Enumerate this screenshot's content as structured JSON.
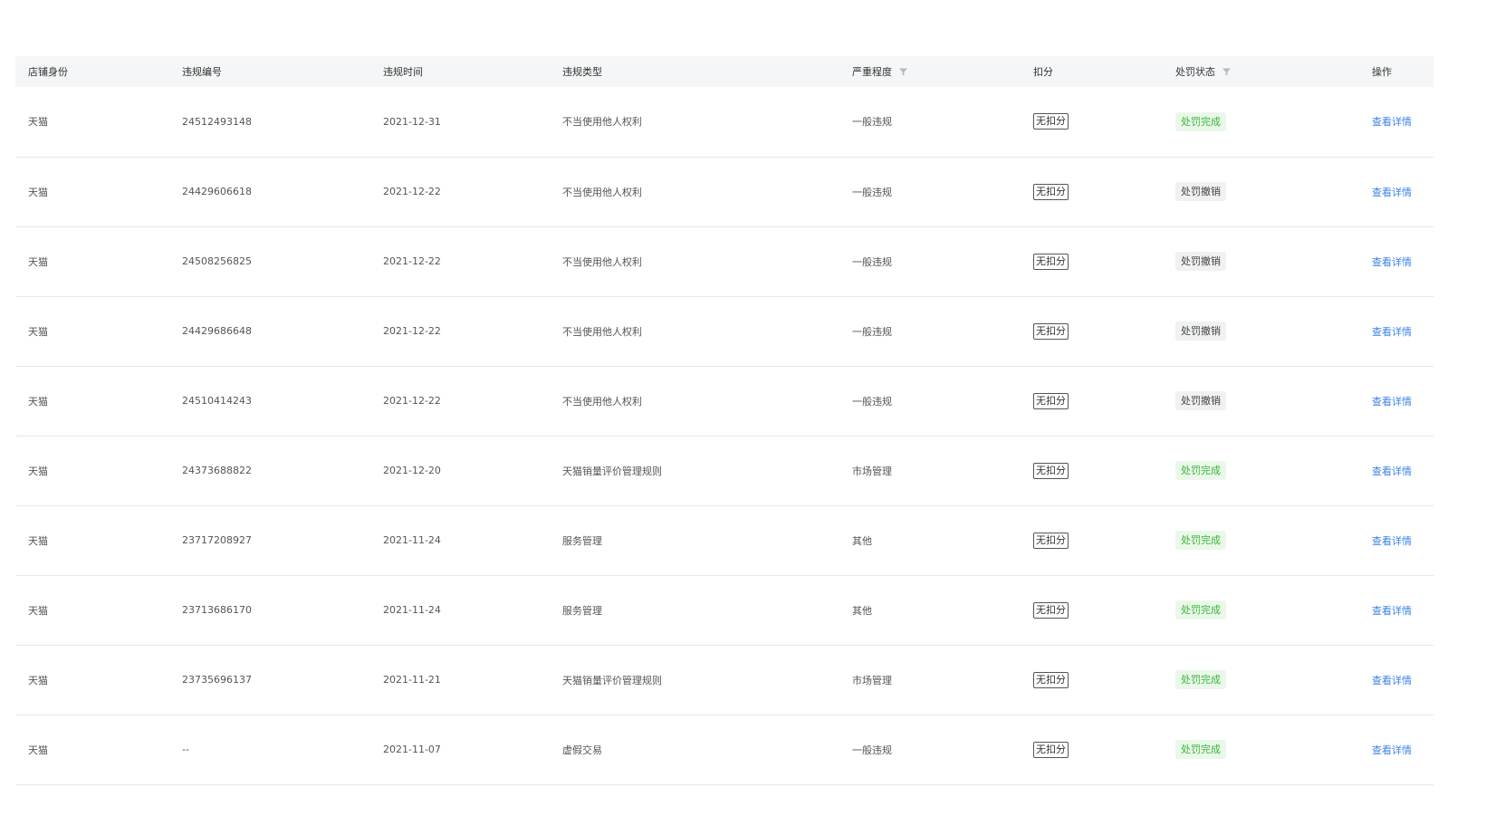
{
  "columns": {
    "shop_identity": "店铺身份",
    "violation_no": "违规编号",
    "violation_time": "违规时间",
    "violation_type": "违规类型",
    "severity": "严重程度",
    "deduction": "扣分",
    "penalty_status": "处罚状态",
    "action": "操作"
  },
  "rows": [
    {
      "shop": "天猫",
      "no": "24512493148",
      "time": "2021-12-31",
      "type": "不当使用他人权利",
      "severity": "一般违规",
      "deduction": "无扣分",
      "status": "处罚完成",
      "status_kind": "done",
      "action": "查看详情"
    },
    {
      "shop": "天猫",
      "no": "24429606618",
      "time": "2021-12-22",
      "type": "不当使用他人权利",
      "severity": "一般违规",
      "deduction": "无扣分",
      "status": "处罚撤销",
      "status_kind": "revoked",
      "action": "查看详情"
    },
    {
      "shop": "天猫",
      "no": "24508256825",
      "time": "2021-12-22",
      "type": "不当使用他人权利",
      "severity": "一般违规",
      "deduction": "无扣分",
      "status": "处罚撤销",
      "status_kind": "revoked",
      "action": "查看详情"
    },
    {
      "shop": "天猫",
      "no": "24429686648",
      "time": "2021-12-22",
      "type": "不当使用他人权利",
      "severity": "一般违规",
      "deduction": "无扣分",
      "status": "处罚撤销",
      "status_kind": "revoked",
      "action": "查看详情"
    },
    {
      "shop": "天猫",
      "no": "24510414243",
      "time": "2021-12-22",
      "type": "不当使用他人权利",
      "severity": "一般违规",
      "deduction": "无扣分",
      "status": "处罚撤销",
      "status_kind": "revoked",
      "action": "查看详情"
    },
    {
      "shop": "天猫",
      "no": "24373688822",
      "time": "2021-12-20",
      "type": "天猫销量评价管理规则",
      "severity": "市场管理",
      "deduction": "无扣分",
      "status": "处罚完成",
      "status_kind": "done",
      "action": "查看详情"
    },
    {
      "shop": "天猫",
      "no": "23717208927",
      "time": "2021-11-24",
      "type": "服务管理",
      "severity": "其他",
      "deduction": "无扣分",
      "status": "处罚完成",
      "status_kind": "done",
      "action": "查看详情"
    },
    {
      "shop": "天猫",
      "no": "23713686170",
      "time": "2021-11-24",
      "type": "服务管理",
      "severity": "其他",
      "deduction": "无扣分",
      "status": "处罚完成",
      "status_kind": "done",
      "action": "查看详情"
    },
    {
      "shop": "天猫",
      "no": "23735696137",
      "time": "2021-11-21",
      "type": "天猫销量评价管理规则",
      "severity": "市场管理",
      "deduction": "无扣分",
      "status": "处罚完成",
      "status_kind": "done",
      "action": "查看详情"
    },
    {
      "shop": "天猫",
      "no": "--",
      "time": "2021-11-07",
      "type": "虚假交易",
      "severity": "一般违规",
      "deduction": "无扣分",
      "status": "处罚完成",
      "status_kind": "done",
      "action": "查看详情"
    }
  ],
  "colors": {
    "header_bg": "#f5f6f7",
    "status_done_bg": "#eaf8ea",
    "status_done_text": "#3ab53a",
    "status_revoked_bg": "#f0f1f2",
    "link": "#3b82e6"
  },
  "icons": {
    "severity_filter": "filter-icon",
    "status_filter": "filter-icon"
  }
}
